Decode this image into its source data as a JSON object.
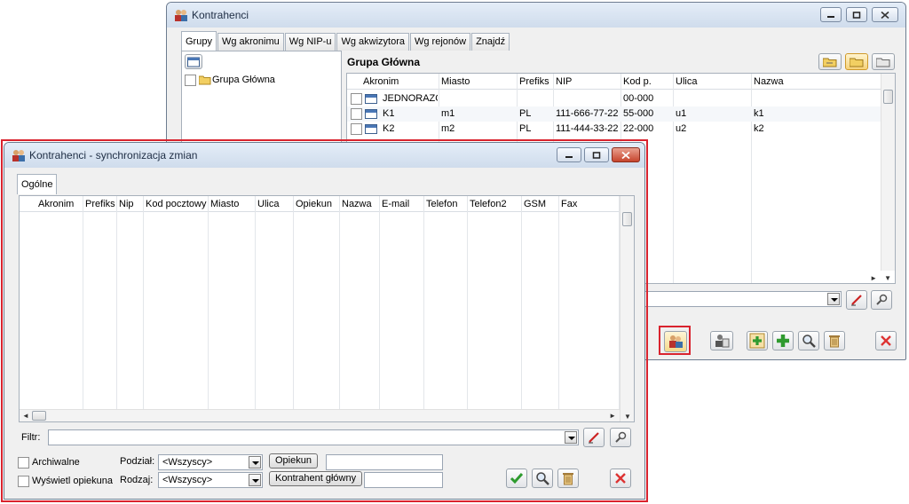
{
  "back_window": {
    "title": "Kontrahenci",
    "tabs": [
      "Grupy",
      "Wg akronimu",
      "Wg NIP-u",
      "Wg akwizytora",
      "Wg rejonów",
      "Znajdź"
    ],
    "tree_root": "Grupa Główna",
    "group_title": "Grupa Główna",
    "columns": [
      "Akronim",
      "Miasto",
      "Prefiks",
      "NIP",
      "Kod p.",
      "Ulica",
      "Nazwa"
    ],
    "rows": [
      {
        "akronim": "JEDNORAZOW",
        "miasto": "",
        "prefiks": "",
        "nip": "",
        "kod": "00-000",
        "ulica": "",
        "nazwa": ""
      },
      {
        "akronim": "K1",
        "miasto": "m1",
        "prefiks": "PL",
        "nip": "111-666-77-22",
        "kod": "55-000",
        "ulica": "u1",
        "nazwa": "k1"
      },
      {
        "akronim": "K2",
        "miasto": "m2",
        "prefiks": "PL",
        "nip": "111-444-33-22",
        "kod": "22-000",
        "ulica": "u2",
        "nazwa": "k2"
      }
    ]
  },
  "front_window": {
    "title": "Kontrahenci - synchronizacja zmian",
    "tab": "Ogólne",
    "columns": [
      "Akronim",
      "Prefiks",
      "Nip",
      "Kod pocztowy",
      "Miasto",
      "Ulica",
      "Opiekun",
      "Nazwa",
      "E-mail",
      "Telefon",
      "Telefon2",
      "GSM",
      "Fax"
    ],
    "filter_label": "Filtr:",
    "filter_value": "",
    "archiwalne_label": "Archiwalne",
    "wyswietl_label": "Wyświetl opiekuna",
    "podzial_label": "Podział:",
    "podzial_value": "<Wszyscy>",
    "rodzaj_label": "Rodzaj:",
    "rodzaj_value": "<Wszyscy>",
    "opiekun_button": "Opiekun",
    "kontrahent_button": "Kontrahent główny"
  },
  "colors": {
    "highlight": "#d9232e",
    "accent": "#4a77b6"
  },
  "icons": [
    "window-icon",
    "folder-icon",
    "contractors-icon",
    "plus-icon",
    "magnifier-icon",
    "trash-icon",
    "close-icon",
    "check-icon",
    "eraser-icon",
    "wrench-icon"
  ]
}
